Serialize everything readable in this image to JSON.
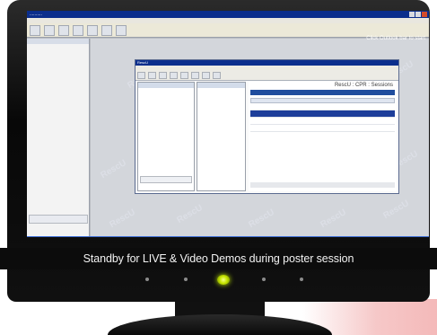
{
  "screen": {
    "title_bar": "..........",
    "hint_text": "Click Outlook bar to start",
    "watermark_text": "RescU",
    "nested_window_title": "RescU",
    "nested_pane_title": "RescU : CPR : Sessions"
  },
  "caption": {
    "text": "Standby for LIVE & Video Demos during poster session"
  },
  "colors": {
    "title_blue": "#0b2e8c",
    "caption_bg": "#0c0c0c",
    "power_led": "#c7e600",
    "taskbar": "#2350b3"
  }
}
